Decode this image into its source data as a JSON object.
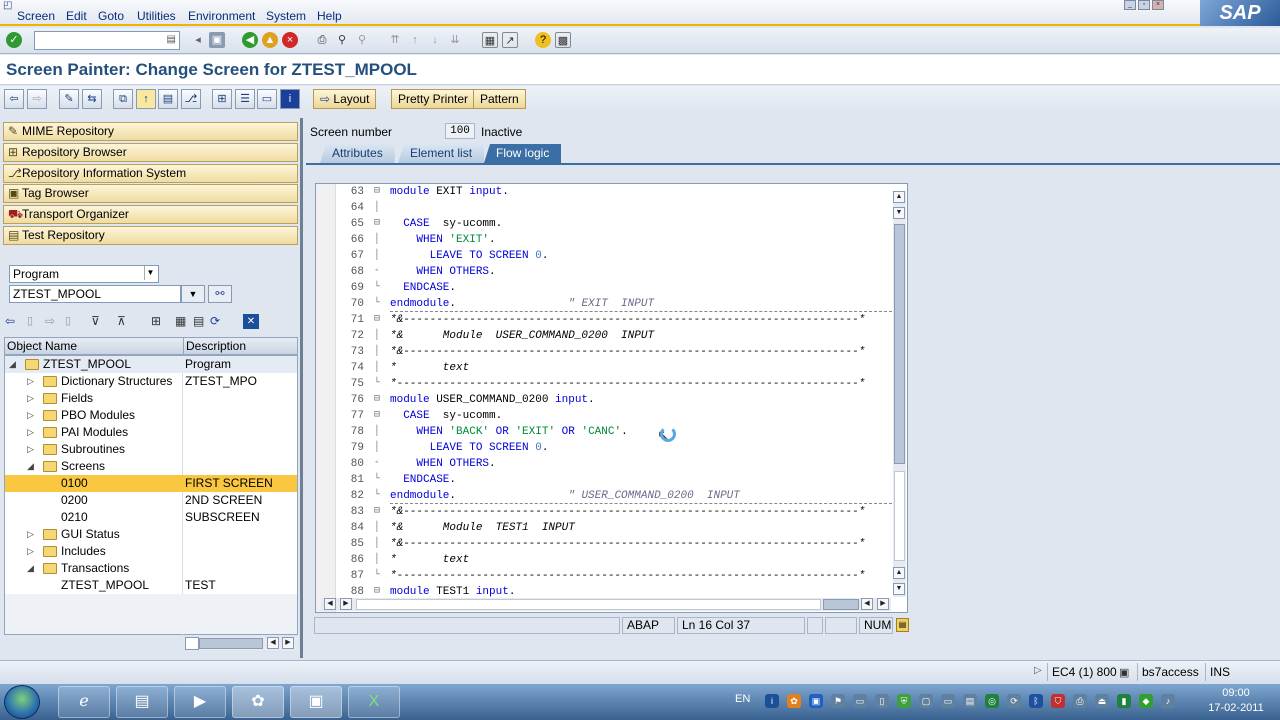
{
  "menu": [
    "Screen",
    "Edit",
    "Goto",
    "Utilities",
    "Environment",
    "System",
    "Help"
  ],
  "brand": "SAP",
  "title": "Screen Painter: Change Screen for ZTEST_MPOOL",
  "app_toolbar": {
    "layout": "Layout",
    "pretty_printer": "Pretty Printer",
    "pattern": "Pattern"
  },
  "nav_buttons": [
    "MIME Repository",
    "Repository Browser",
    "Repository Information System",
    "Tag Browser",
    "Transport Organizer",
    "Test Repository"
  ],
  "object_type": "Program",
  "object_name": "ZTEST_MPOOL",
  "tree": {
    "col_name": "Object Name",
    "col_desc": "Description",
    "rows": [
      {
        "name": "ZTEST_MPOOL",
        "desc": "Program ZTEST_MPO"
      },
      {
        "name": "Dictionary Structures",
        "desc": ""
      },
      {
        "name": "Fields",
        "desc": ""
      },
      {
        "name": "PBO Modules",
        "desc": ""
      },
      {
        "name": "PAI Modules",
        "desc": ""
      },
      {
        "name": "Subroutines",
        "desc": ""
      },
      {
        "name": "Screens",
        "desc": ""
      },
      {
        "name": "0100",
        "desc": "FIRST SCREEN"
      },
      {
        "name": "0200",
        "desc": "2ND SCREEN"
      },
      {
        "name": "0210",
        "desc": "SUBSCREEN"
      },
      {
        "name": "GUI Status",
        "desc": ""
      },
      {
        "name": "Includes",
        "desc": ""
      },
      {
        "name": "Transactions",
        "desc": ""
      },
      {
        "name": "ZTEST_MPOOL",
        "desc": "TEST"
      }
    ]
  },
  "screen": {
    "number_label": "Screen number",
    "number": "100",
    "status": "Inactive"
  },
  "tabs": [
    "Attributes",
    "Element list",
    "Flow logic"
  ],
  "code_lines": [
    {
      "n": "63",
      "t": "module EXIT input."
    },
    {
      "n": "64",
      "t": ""
    },
    {
      "n": "65",
      "t": "  CASE  sy-ucomm."
    },
    {
      "n": "66",
      "t": "    WHEN 'EXIT'."
    },
    {
      "n": "67",
      "t": "      LEAVE TO SCREEN 0."
    },
    {
      "n": "68",
      "t": "    WHEN OTHERS."
    },
    {
      "n": "69",
      "t": "  ENDCASE."
    },
    {
      "n": "70",
      "t": "endmodule.                 \" EXIT  INPUT"
    },
    {
      "n": "71",
      "t": "*&---------------------------------------------------------------------*"
    },
    {
      "n": "72",
      "t": "*&      Module  USER_COMMAND_0200  INPUT"
    },
    {
      "n": "73",
      "t": "*&---------------------------------------------------------------------*"
    },
    {
      "n": "74",
      "t": "*       text"
    },
    {
      "n": "75",
      "t": "*----------------------------------------------------------------------*"
    },
    {
      "n": "76",
      "t": "module USER_COMMAND_0200 input."
    },
    {
      "n": "77",
      "t": "  CASE  sy-ucomm."
    },
    {
      "n": "78",
      "t": "    WHEN 'BACK' OR 'EXIT' OR 'CANC'."
    },
    {
      "n": "79",
      "t": "      LEAVE TO SCREEN 0."
    },
    {
      "n": "80",
      "t": "    WHEN OTHERS."
    },
    {
      "n": "81",
      "t": "  ENDCASE."
    },
    {
      "n": "82",
      "t": "endmodule.                 \" USER_COMMAND_0200  INPUT"
    },
    {
      "n": "83",
      "t": "*&---------------------------------------------------------------------*"
    },
    {
      "n": "84",
      "t": "*&      Module  TEST1  INPUT"
    },
    {
      "n": "85",
      "t": "*&---------------------------------------------------------------------*"
    },
    {
      "n": "86",
      "t": "*       text"
    },
    {
      "n": "87",
      "t": "*----------------------------------------------------------------------*"
    },
    {
      "n": "88",
      "t": "module TEST1 input."
    }
  ],
  "editor_status": {
    "lang": "ABAP",
    "pos": "Ln 16 Col 37",
    "mode": "NUM"
  },
  "sap_status": {
    "system": "EC4 (1) 800",
    "host": "bs7access",
    "mode": "INS"
  },
  "taskbar": {
    "lang": "EN",
    "time": "09:00",
    "date": "17-02-2011"
  },
  "colors": {
    "accent": "#f0b400",
    "title": "#24507e",
    "selected_row": "#f9c840",
    "tab_active": "#3a6ea5"
  }
}
